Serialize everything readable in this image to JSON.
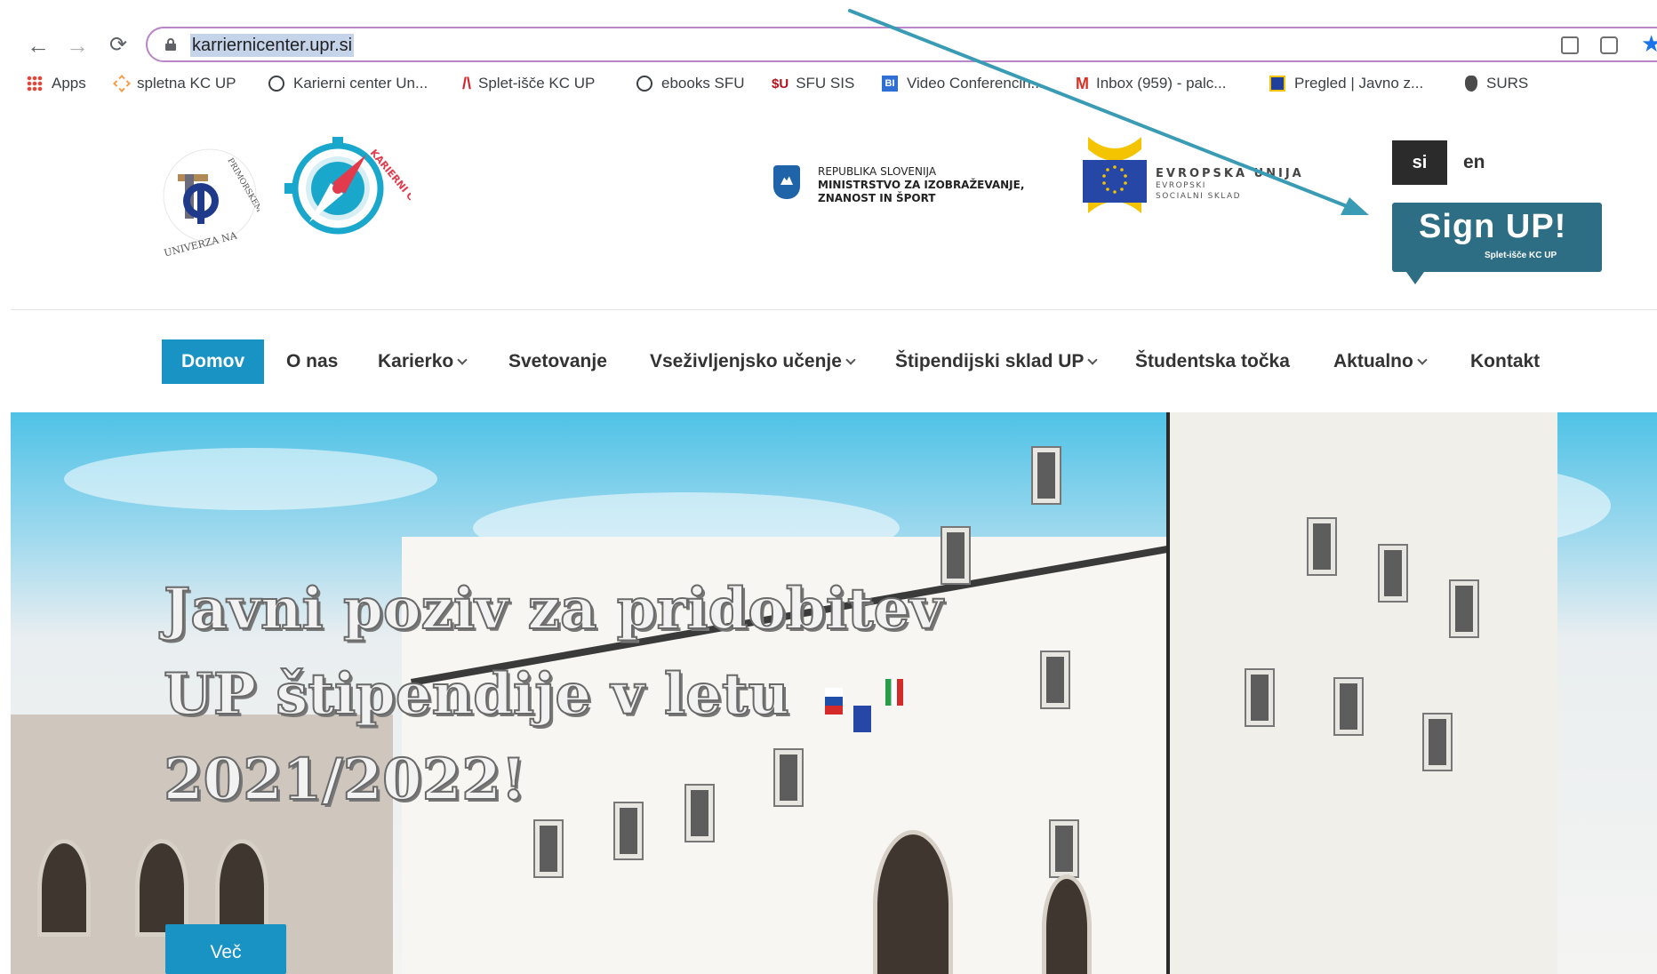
{
  "browser": {
    "url": "karriernicenter.upr.si",
    "bookmarks": [
      {
        "label": "Apps",
        "icon": "apps-grid-icon"
      },
      {
        "label": "spletna KC UP",
        "icon": "kc-logo-icon"
      },
      {
        "label": "Karierni center Un...",
        "icon": "globe-icon"
      },
      {
        "label": "Splet-išče KC UP",
        "icon": "splet-logo-icon"
      },
      {
        "label": "ebooks SFU",
        "icon": "globe-icon"
      },
      {
        "label": "SFU SIS",
        "icon": "sfu-logo-icon"
      },
      {
        "label": "Video Conferencin...",
        "icon": "video-conference-icon"
      },
      {
        "label": "Inbox (959) - palc...",
        "icon": "gmail-icon"
      },
      {
        "label": "Pregled | Javno z...",
        "icon": "eu-flag-icon"
      },
      {
        "label": "SURS",
        "icon": "surs-icon"
      }
    ]
  },
  "header": {
    "mizs": {
      "line1": "REPUBLIKA SLOVENIJA",
      "line2": "MINISTRSTVO ZA IZOBRAŽEVANJE,",
      "line3": "ZNANOST IN ŠPORT"
    },
    "eu": {
      "line1": "EVROPSKA UNIJA",
      "line2": "EVROPSKI",
      "line3": "SOCIALNI SKLAD"
    },
    "logo_up_text": "UNIVERZA NA PRIMORSKEM",
    "logo_kc_text": "KARIERNI CENTER",
    "lang_si": "si",
    "lang_en": "en",
    "signup_big": "Sign UP!",
    "signup_small": "Splet-išče KC UP"
  },
  "nav": {
    "items": [
      {
        "label": "Domov",
        "active": true,
        "dropdown": false
      },
      {
        "label": "O nas",
        "active": false,
        "dropdown": false
      },
      {
        "label": "Karierko",
        "active": false,
        "dropdown": true
      },
      {
        "label": "Svetovanje",
        "active": false,
        "dropdown": false
      },
      {
        "label": "Vseživljenjsko učenje",
        "active": false,
        "dropdown": true
      },
      {
        "label": "Štipendijski sklad UP",
        "active": false,
        "dropdown": true
      },
      {
        "label": "Študentska točka",
        "active": false,
        "dropdown": false
      },
      {
        "label": "Aktualno",
        "active": false,
        "dropdown": true
      },
      {
        "label": "Kontakt",
        "active": false,
        "dropdown": false
      }
    ]
  },
  "hero": {
    "title_line1": "Javni poziv za pridobitev",
    "title_line2": "UP štipendije v letu",
    "title_line3": "2021/2022!",
    "button": "Več"
  },
  "colors": {
    "accent": "#1993c3",
    "annotation_arrow": "#3a9bb5",
    "signup": "#2e6e85"
  }
}
